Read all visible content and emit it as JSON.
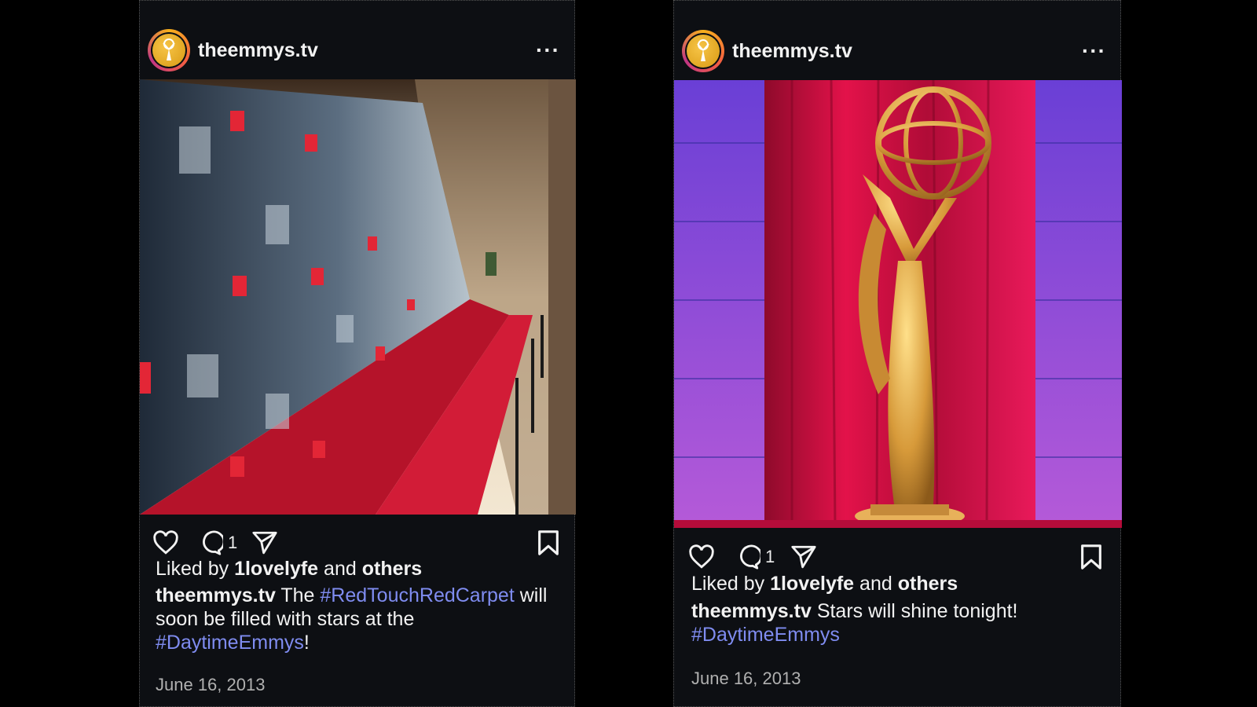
{
  "posts": [
    {
      "username": "theemmys.tv",
      "more_icon": "more-horizontal-icon",
      "comment_count": "1",
      "liked_prefix": "Liked by",
      "liked_user": "1lovelyfe",
      "liked_and": "and",
      "liked_others": "others",
      "caption_user": "theemmys.tv",
      "caption_parts": [
        "The",
        "#RedTouchRedCarpet",
        "will soon be filled with stars at the",
        "#DaytimeEmmys",
        "!"
      ],
      "date": "June 16, 2013",
      "photo_subject": "red carpet with Daytime Emmy step-and-repeat wall"
    },
    {
      "username": "theemmys.tv",
      "more_icon": "more-horizontal-icon",
      "comment_count": "1",
      "liked_prefix": "Liked by",
      "liked_user": "1lovelyfe",
      "liked_and": "and",
      "liked_others": "others",
      "caption_user": "theemmys.tv",
      "caption_parts": [
        "Stars will shine tonight!",
        "#DaytimeEmmys"
      ],
      "date": "June 16, 2013",
      "photo_subject": "golden Emmy statue in front of red curtain"
    }
  ],
  "colors": {
    "hashtag": "#7f8cf0",
    "background": "#0d0f13",
    "ring": "#f7b01c"
  }
}
